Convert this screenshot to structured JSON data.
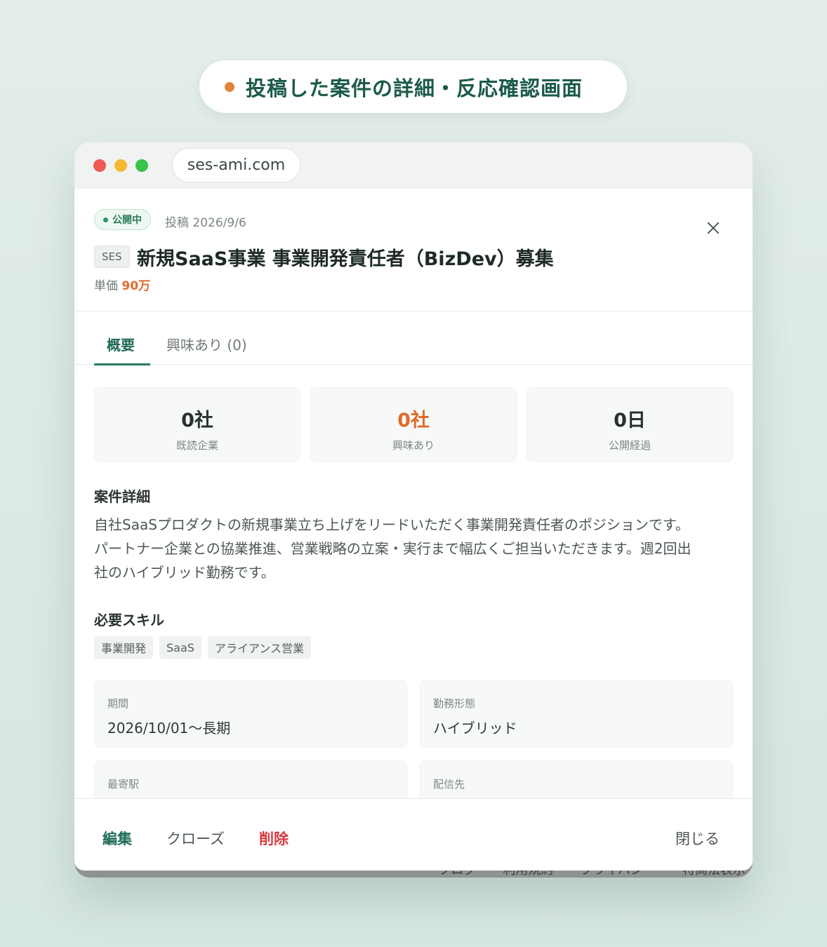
{
  "banner": {
    "title": "投稿した案件の詳細・反応確認画面"
  },
  "browser": {
    "url": "ses-ami.com"
  },
  "job": {
    "status": "公開中",
    "posted": "投稿 2026/9/6",
    "type": "SES",
    "title": "新規SaaS事業 事業開発責任者（BizDev）募集",
    "rate_label": "単価",
    "rate_value": "90万"
  },
  "tabs": {
    "overview": "概要",
    "interest": "興味あり (0)"
  },
  "stats": [
    {
      "value": "0社",
      "label": "既読企業"
    },
    {
      "value": "0社",
      "label": "興味あり"
    },
    {
      "value": "0日",
      "label": "公開経過"
    }
  ],
  "details": {
    "heading": "案件詳細",
    "line1": "自社SaaSプロダクトの新規事業立ち上げをリードいただく事業開発責任者のポジションです。",
    "line2": "パートナー企業との協業推進、営業戦略の立案・実行まで幅広くご担当いただきます。週2回出",
    "line3": "社のハイブリッド勤務です。"
  },
  "skills": {
    "heading": "必要スキル",
    "items": [
      "事業開発",
      "SaaS",
      "アライアンス営業"
    ]
  },
  "fields": {
    "period": {
      "label": "期間",
      "value": "2026/10/01〜長期"
    },
    "work_style": {
      "label": "勤務形態",
      "value": "ハイブリッド"
    },
    "station": {
      "label": "最寄駅",
      "value": ""
    },
    "distribution": {
      "label": "配信先",
      "value": ""
    }
  },
  "footer": {
    "edit": "編集",
    "close_job": "クローズ",
    "delete": "削除",
    "dismiss": "閉じる"
  },
  "site_footer": [
    "ブログ",
    "利用規約",
    "プライバシー",
    "特商法表示"
  ],
  "colors": {
    "accent": "#1f6b57",
    "highlight": "#e06a2c",
    "danger": "#d9363e"
  }
}
